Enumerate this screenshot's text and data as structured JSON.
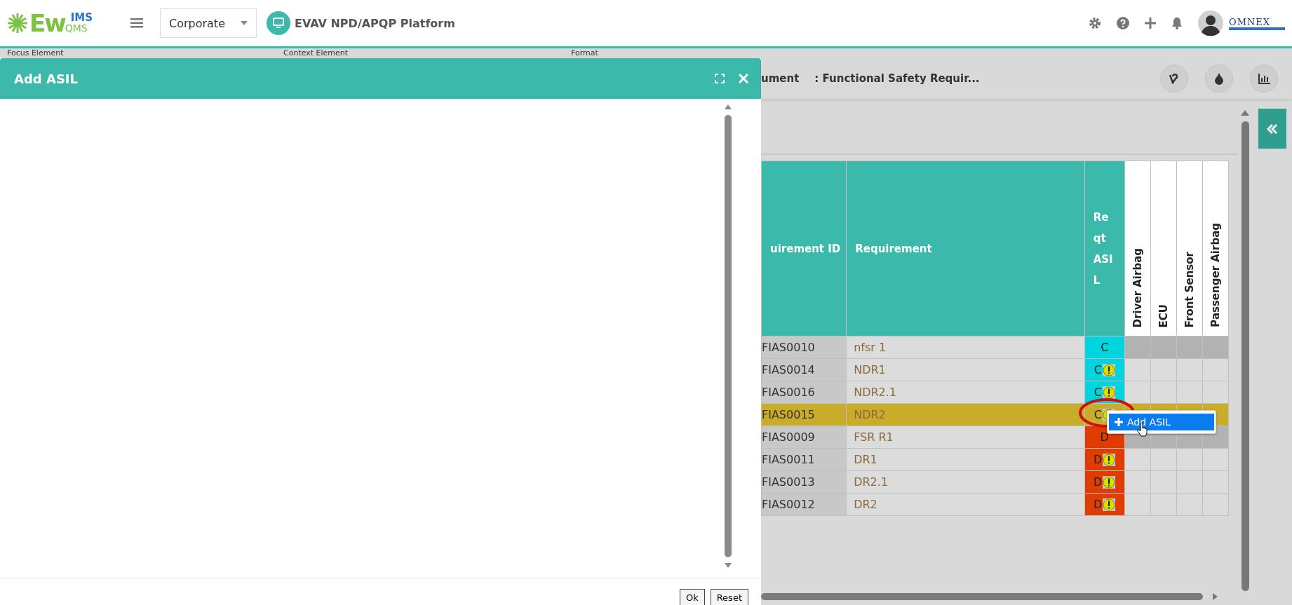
{
  "header": {
    "logo": {
      "main": "Ew",
      "top": "IMS",
      "bottom": "QMS"
    },
    "site_select": {
      "value": "Corporate"
    },
    "platform": "EVAV NPD/APQP Platform",
    "brand": "OMNEX"
  },
  "filter_labels": [
    "Focus Element",
    "Context Element",
    "Format"
  ],
  "dialog": {
    "title": "Add ASIL",
    "buttons": [
      "Ok",
      "Reset"
    ]
  },
  "document": {
    "label": "ument",
    "value": ": Functional Safety Requir..."
  },
  "table": {
    "columns": [
      {
        "label": "uirement ID",
        "kind": "id"
      },
      {
        "label": "Requirement",
        "kind": "text"
      },
      {
        "label": "Reqt ASIL",
        "kind": "asil"
      },
      {
        "label": "Driver Airbag",
        "kind": "target"
      },
      {
        "label": "ECU",
        "kind": "target"
      },
      {
        "label": "Front Sensor",
        "kind": "target"
      },
      {
        "label": "Passenger Airbag",
        "kind": "target"
      }
    ],
    "rows": [
      {
        "id": "FIAS0010",
        "requirement": "nfsr 1",
        "asil": "C",
        "color": "#00d4dc",
        "warning": false,
        "selected": false,
        "shaded": true
      },
      {
        "id": "FIAS0014",
        "requirement": "NDR1",
        "asil": "C",
        "color": "#00d4dc",
        "warning": true,
        "selected": false,
        "shaded": false
      },
      {
        "id": "FIAS0016",
        "requirement": "NDR2.1",
        "asil": "C",
        "color": "#00d4dc",
        "warning": true,
        "selected": false,
        "shaded": false
      },
      {
        "id": "FIAS0015",
        "requirement": "NDR2",
        "asil": "C",
        "color": "#c9ac2a",
        "warning": true,
        "selected": true,
        "shaded": false
      },
      {
        "id": "FIAS0009",
        "requirement": "FSR R1",
        "asil": "D",
        "color": "#e03c00",
        "warning": false,
        "selected": false,
        "shaded": true
      },
      {
        "id": "FIAS0011",
        "requirement": "DR1",
        "asil": "D",
        "color": "#e03c00",
        "warning": true,
        "selected": false,
        "shaded": false
      },
      {
        "id": "FIAS0013",
        "requirement": "DR2.1",
        "asil": "D",
        "color": "#e03c00",
        "warning": true,
        "selected": false,
        "shaded": false
      },
      {
        "id": "FIAS0012",
        "requirement": "DR2",
        "asil": "D",
        "color": "#e03c00",
        "warning": true,
        "selected": false,
        "shaded": false
      }
    ]
  },
  "context_menu": {
    "item": "Add ASIL"
  }
}
